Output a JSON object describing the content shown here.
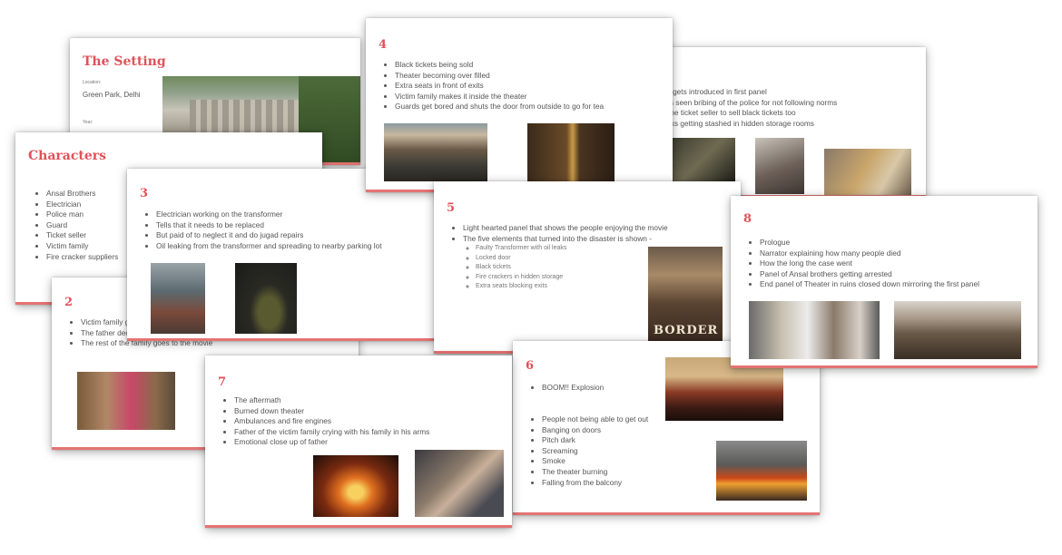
{
  "slides": {
    "setting": {
      "title": "The Setting",
      "location_label": "Location:",
      "location": "Green Park, Delhi",
      "year_label": "Year:"
    },
    "characters": {
      "title": "Characters",
      "items": [
        "Ansal Brothers",
        "Electrician",
        "Police man",
        "Guard",
        "Ticket seller",
        "Victim family",
        "Fire cracker suppliers"
      ]
    },
    "s2": {
      "num": "2",
      "items": [
        "Victim family getting ready to go for a movie",
        "The father decides to stay at home",
        "The rest of the family goes to the movie"
      ]
    },
    "s3": {
      "num": "3",
      "items": [
        "Electrician working on the transformer",
        "Tells that it needs to be replaced",
        "But paid of to neglect it and do jugad repairs",
        "Oil leaking from the transformer and spreading to nearby parking lot"
      ]
    },
    "s4": {
      "num": "4",
      "items": [
        "Black tickets being sold",
        "Theater becoming over filled",
        "Extra seats in front of exits",
        "Victim family makes it inside the theater",
        "Guards get bored and shuts the door from outside to go for tea"
      ]
    },
    "s5": {
      "num": "5",
      "items": [
        "Light hearted panel that shows the people enjoying the movie",
        "The five elements that turned into the disaster is shown -"
      ],
      "subitems": [
        "Faulty Transformer with oil leaks",
        "Locked door",
        "Black tickets",
        "Fire crackers in hidden storage",
        "Extra seats blocking exits"
      ],
      "poster_text": "BORDER"
    },
    "s6": {
      "num": "6",
      "first": "BOOM!! Explosion",
      "items": [
        "People not being able to get out",
        "Banging on doors",
        "Pitch dark",
        "Screaming",
        "Smoke",
        "The theater burning",
        "Falling from the balcony"
      ]
    },
    "s7": {
      "num": "7",
      "items": [
        "The aftermath",
        "Burned down theater",
        "Ambulances and fire engines",
        "Father of the victim family crying with his family in his arms",
        "Emotional close up of father"
      ]
    },
    "s8": {
      "num": "8",
      "items": [
        "Prologue",
        "Narrator explaining how many people died",
        "How the long the case went",
        "Panel of Ansal brothers getting arrested",
        "End panel of Theater in ruins closed down mirroring the first panel"
      ]
    },
    "bg": {
      "items": [
        "r gets introduced in first panel",
        "is seen bribing of the police for not following norms",
        "the ticket seller to sell black tickets too",
        "rks getting stashed in hidden storage rooms"
      ]
    }
  },
  "colors": {
    "accent": "#e0525a",
    "underline": "#e57373"
  }
}
